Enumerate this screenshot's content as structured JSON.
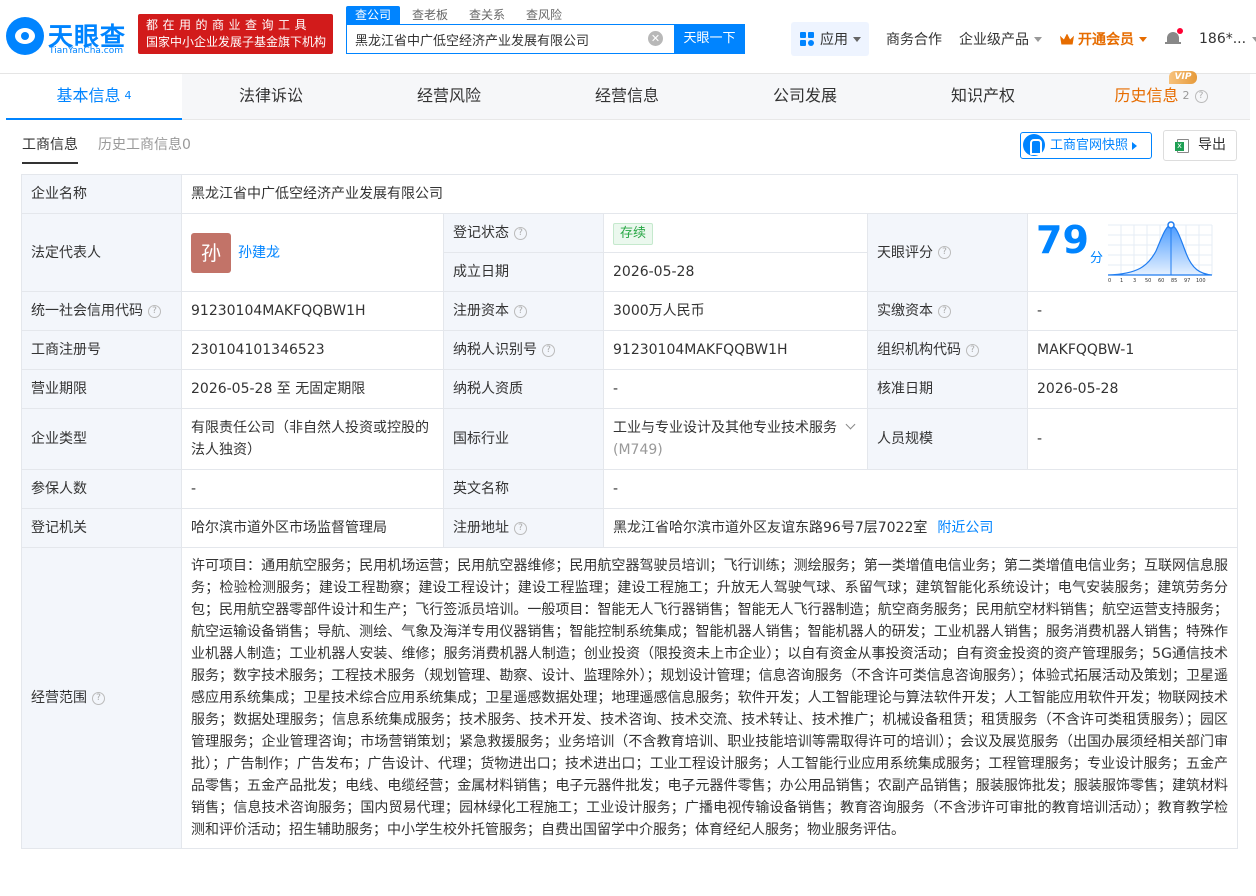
{
  "header": {
    "logo_text": "天眼查",
    "logo_sub": "TianYanCha.com",
    "slogan_line1": "都在用的商业查询工具",
    "slogan_line2": "国家中小企业发展子基金旗下机构",
    "search_tabs": [
      "查公司",
      "查老板",
      "查关系",
      "查风险"
    ],
    "search_value": "黑龙江省中广低空经济产业发展有限公司",
    "search_button": "天眼一下",
    "nav_app": "应用",
    "nav_items": [
      "商务合作",
      "企业级产品"
    ],
    "vip_label": "开通会员",
    "user": "186*..."
  },
  "main_tabs": [
    {
      "label": "基本信息",
      "count": "4"
    },
    {
      "label": "法律诉讼"
    },
    {
      "label": "经营风险"
    },
    {
      "label": "经营信息"
    },
    {
      "label": "公司发展"
    },
    {
      "label": "知识产权"
    },
    {
      "label": "历史信息",
      "count": "2",
      "badge": "VIP"
    }
  ],
  "sub_tabs": [
    "工商信息",
    "历史工商信息0"
  ],
  "snapshot_button": "工商官网快照",
  "export_button": "导出",
  "info": {
    "name_label": "企业名称",
    "name": "黑龙江省中广低空经济产业发展有限公司",
    "legal_label": "法定代表人",
    "legal_avatar": "孙",
    "legal_name": "孙建龙",
    "status_label": "登记状态",
    "status": "存续",
    "founded_label": "成立日期",
    "founded": "2026-05-28",
    "score_label": "天眼评分",
    "score": "79",
    "score_unit": "分",
    "score_ticks": [
      "0",
      "1",
      "3",
      "50",
      "60",
      "85",
      "97",
      "100"
    ],
    "credit_label": "统一社会信用代码",
    "credit": "91230104MAKFQQBW1H",
    "capital_label": "注册资本",
    "capital": "3000万人民币",
    "paid_label": "实缴资本",
    "paid": "-",
    "regno_label": "工商注册号",
    "regno": "230104101346523",
    "taxid_label": "纳税人识别号",
    "taxid": "91230104MAKFQQBW1H",
    "orgcode_label": "组织机构代码",
    "orgcode": "MAKFQQBW-1",
    "term_label": "营业期限",
    "term": "2026-05-28 至 无固定期限",
    "taxqual_label": "纳税人资质",
    "taxqual": "-",
    "approve_label": "核准日期",
    "approve": "2026-05-28",
    "type_label": "企业类型",
    "type": "有限责任公司（非自然人投资或控股的法人独资）",
    "industry_label": "国标行业",
    "industry": "工业与专业设计及其他专业技术服务",
    "industry_code": "(M749)",
    "staff_label": "人员规模",
    "staff": "-",
    "insured_label": "参保人数",
    "insured": "-",
    "en_label": "英文名称",
    "en": "-",
    "authority_label": "登记机关",
    "authority": "哈尔滨市道外区市场监督管理局",
    "address_label": "注册地址",
    "address": "黑龙江省哈尔滨市道外区友谊东路96号7层7022室",
    "nearby": "附近公司",
    "scope_label": "经营范围",
    "scope": "许可项目：通用航空服务；民用机场运营；民用航空器维修；民用航空器驾驶员培训；飞行训练；测绘服务；第一类增值电信业务；第二类增值电信业务；互联网信息服务；检验检测服务；建设工程勘察；建设工程设计；建设工程监理；建设工程施工；升放无人驾驶气球、系留气球；建筑智能化系统设计；电气安装服务；建筑劳务分包；民用航空器零部件设计和生产；飞行签派员培训。一般项目：智能无人飞行器销售；智能无人飞行器制造；航空商务服务；民用航空材料销售；航空运营支持服务；航空运输设备销售；导航、测绘、气象及海洋专用仪器销售；智能控制系统集成；智能机器人销售；智能机器人的研发；工业机器人销售；服务消费机器人销售；特殊作业机器人制造；工业机器人安装、维修；服务消费机器人制造；创业投资（限投资未上市企业）；以自有资金从事投资活动；自有资金投资的资产管理服务；5G通信技术服务；数字技术服务；工程技术服务（规划管理、勘察、设计、监理除外）；规划设计管理；信息咨询服务（不含许可类信息咨询服务）；体验式拓展活动及策划；卫星遥感应用系统集成；卫星技术综合应用系统集成；卫星遥感数据处理；地理遥感信息服务；软件开发；人工智能理论与算法软件开发；人工智能应用软件开发；物联网技术服务；数据处理服务；信息系统集成服务；技术服务、技术开发、技术咨询、技术交流、技术转让、技术推广；机械设备租赁；租赁服务（不含许可类租赁服务）；园区管理服务；企业管理咨询；市场营销策划；紧急救援服务；业务培训（不含教育培训、职业技能培训等需取得许可的培训）；会议及展览服务（出国办展须经相关部门审批）；广告制作；广告发布；广告设计、代理；货物进出口；技术进出口；工业工程设计服务；人工智能行业应用系统集成服务；工程管理服务；专业设计服务；五金产品零售；五金产品批发；电线、电缆经营；金属材料销售；电子元器件批发；电子元器件零售；办公用品销售；农副产品销售；服装服饰批发；服装服饰零售；建筑材料销售；信息技术咨询服务；国内贸易代理；园林绿化工程施工；工业设计服务；广播电视传输设备销售；教育咨询服务（不含涉许可审批的教育培训活动）；教育教学检测和评价活动；招生辅助服务；中小学生校外托管服务；自费出国留学中介服务；体育经纪人服务；物业服务评估。"
  },
  "colors": {
    "brand": "#0084ff",
    "slogan_bg": "#d21b1b",
    "vip": "#e66c00",
    "label_bg": "#f3f6fb"
  }
}
